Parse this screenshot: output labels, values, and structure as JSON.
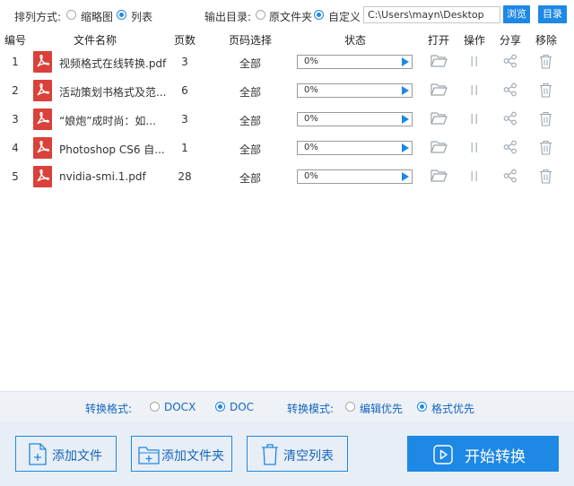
{
  "toolbar": {
    "sort_label": "排列方式:",
    "sort_options": [
      "缩略图",
      "列表"
    ],
    "sort_selected": "列表",
    "output_label": "输出目录:",
    "output_options": [
      "原文件夹",
      "自定义"
    ],
    "output_selected": "自定义",
    "path_value": "C:\\Users\\mayn\\Desktop",
    "browse_label": "浏览",
    "directory_label": "目录"
  },
  "table": {
    "headers": [
      "编号",
      "文件名称",
      "页数",
      "页码选择",
      "状态",
      "打开",
      "操作",
      "分享",
      "移除"
    ],
    "rows": [
      {
        "index": "1",
        "name": "视频格式在线转换.pdf",
        "pages": "3",
        "range": "全部",
        "progress_text": "0%",
        "progress": 0
      },
      {
        "index": "2",
        "name": "活动策划书格式及范...",
        "pages": "6",
        "range": "全部",
        "progress_text": "0%",
        "progress": 0
      },
      {
        "index": "3",
        "name": "“娘炮”成时尚：如...",
        "pages": "3",
        "range": "全部",
        "progress_text": "0%",
        "progress": 0
      },
      {
        "index": "4",
        "name": "Photoshop CS6 自...",
        "pages": "1",
        "range": "全部",
        "progress_text": "0%",
        "progress": 0
      },
      {
        "index": "5",
        "name": "nvidia-smi.1.pdf",
        "pages": "28",
        "range": "全部",
        "progress_text": "0%",
        "progress": 0
      }
    ]
  },
  "format_bar": {
    "format_label": "转换格式:",
    "format_options": [
      "DOCX",
      "DOC"
    ],
    "format_selected": "DOC",
    "mode_label": "转换模式:",
    "mode_options": [
      "编辑优先",
      "格式优先"
    ],
    "mode_selected": "格式优先"
  },
  "actions": {
    "add_file": "添加文件",
    "add_folder": "添加文件夹",
    "clear_list": "清空列表",
    "start": "开始转换"
  },
  "colors": {
    "accent": "#1e88e5",
    "pdf_red": "#d9413a",
    "bottom_bg": "#e8eef5"
  }
}
